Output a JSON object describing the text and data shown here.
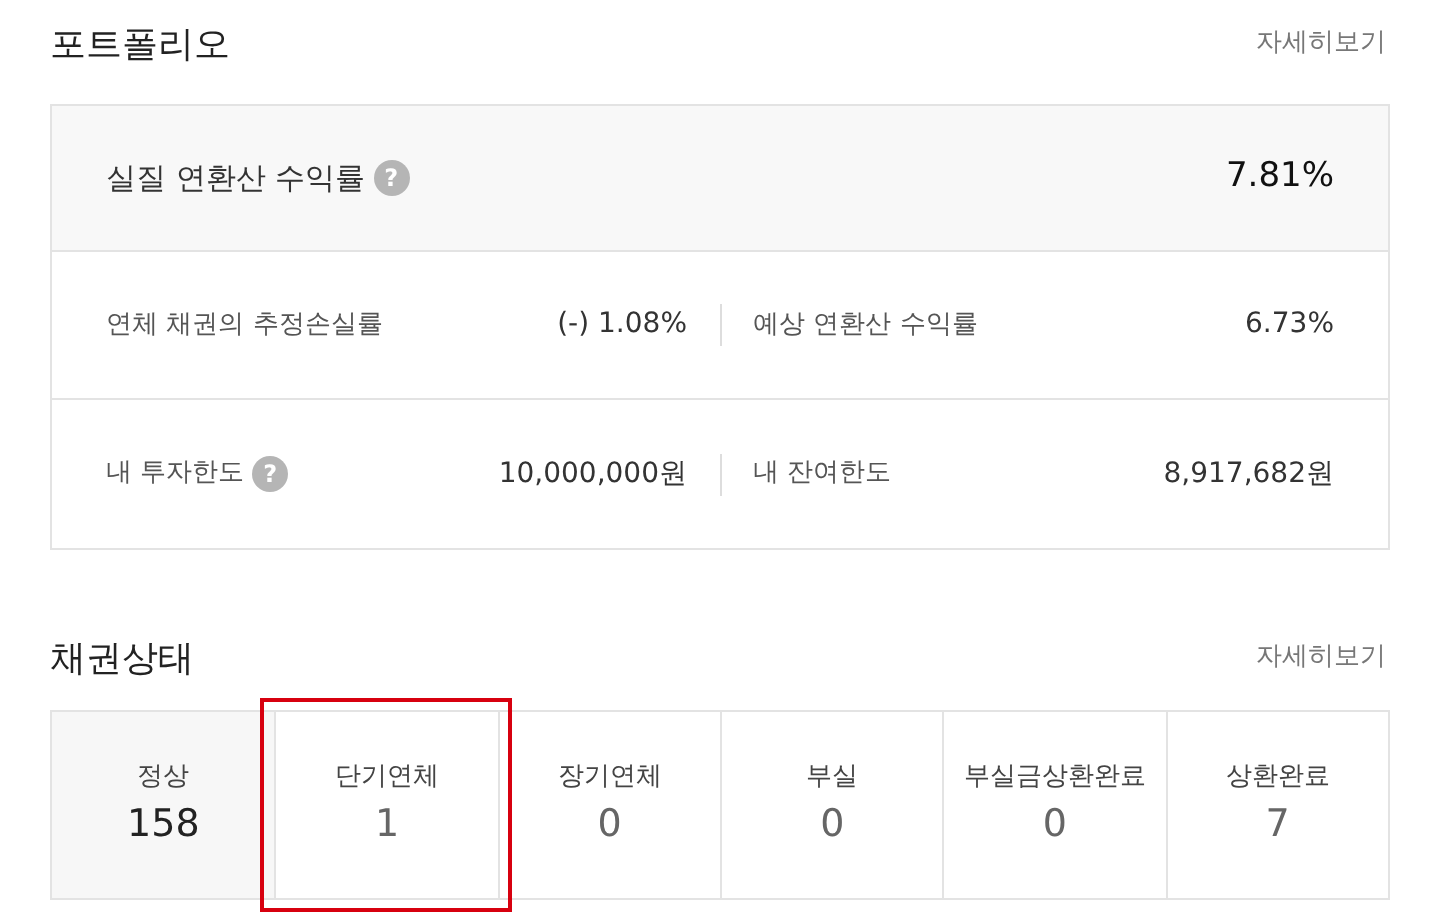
{
  "portfolio": {
    "title": "포트폴리오",
    "more_link": "자세히보기",
    "headline": {
      "label": "실질 연환산 수익률",
      "help": "?",
      "value": "7.81%"
    },
    "rows": [
      [
        {
          "label": "연체 채권의 추정손실률",
          "value": "(-) 1.08%"
        },
        {
          "label": "예상 연환산 수익률",
          "value": "6.73%"
        }
      ],
      [
        {
          "label": "내 투자한도",
          "help": "?",
          "value": "10,000,000원"
        },
        {
          "label": "내 잔여한도",
          "value": "8,917,682원"
        }
      ]
    ]
  },
  "bond_status": {
    "title": "채권상태",
    "more_link": "자세히보기",
    "statuses": [
      {
        "label": "정상",
        "count": "158",
        "selected": true,
        "highlighted": false
      },
      {
        "label": "단기연체",
        "count": "1",
        "selected": false,
        "highlighted": true
      },
      {
        "label": "장기연체",
        "count": "0",
        "selected": false,
        "highlighted": false
      },
      {
        "label": "부실",
        "count": "0",
        "selected": false,
        "highlighted": false
      },
      {
        "label": "부실금상환완료",
        "count": "0",
        "selected": false,
        "highlighted": false
      },
      {
        "label": "상환완료",
        "count": "7",
        "selected": false,
        "highlighted": false
      }
    ]
  }
}
